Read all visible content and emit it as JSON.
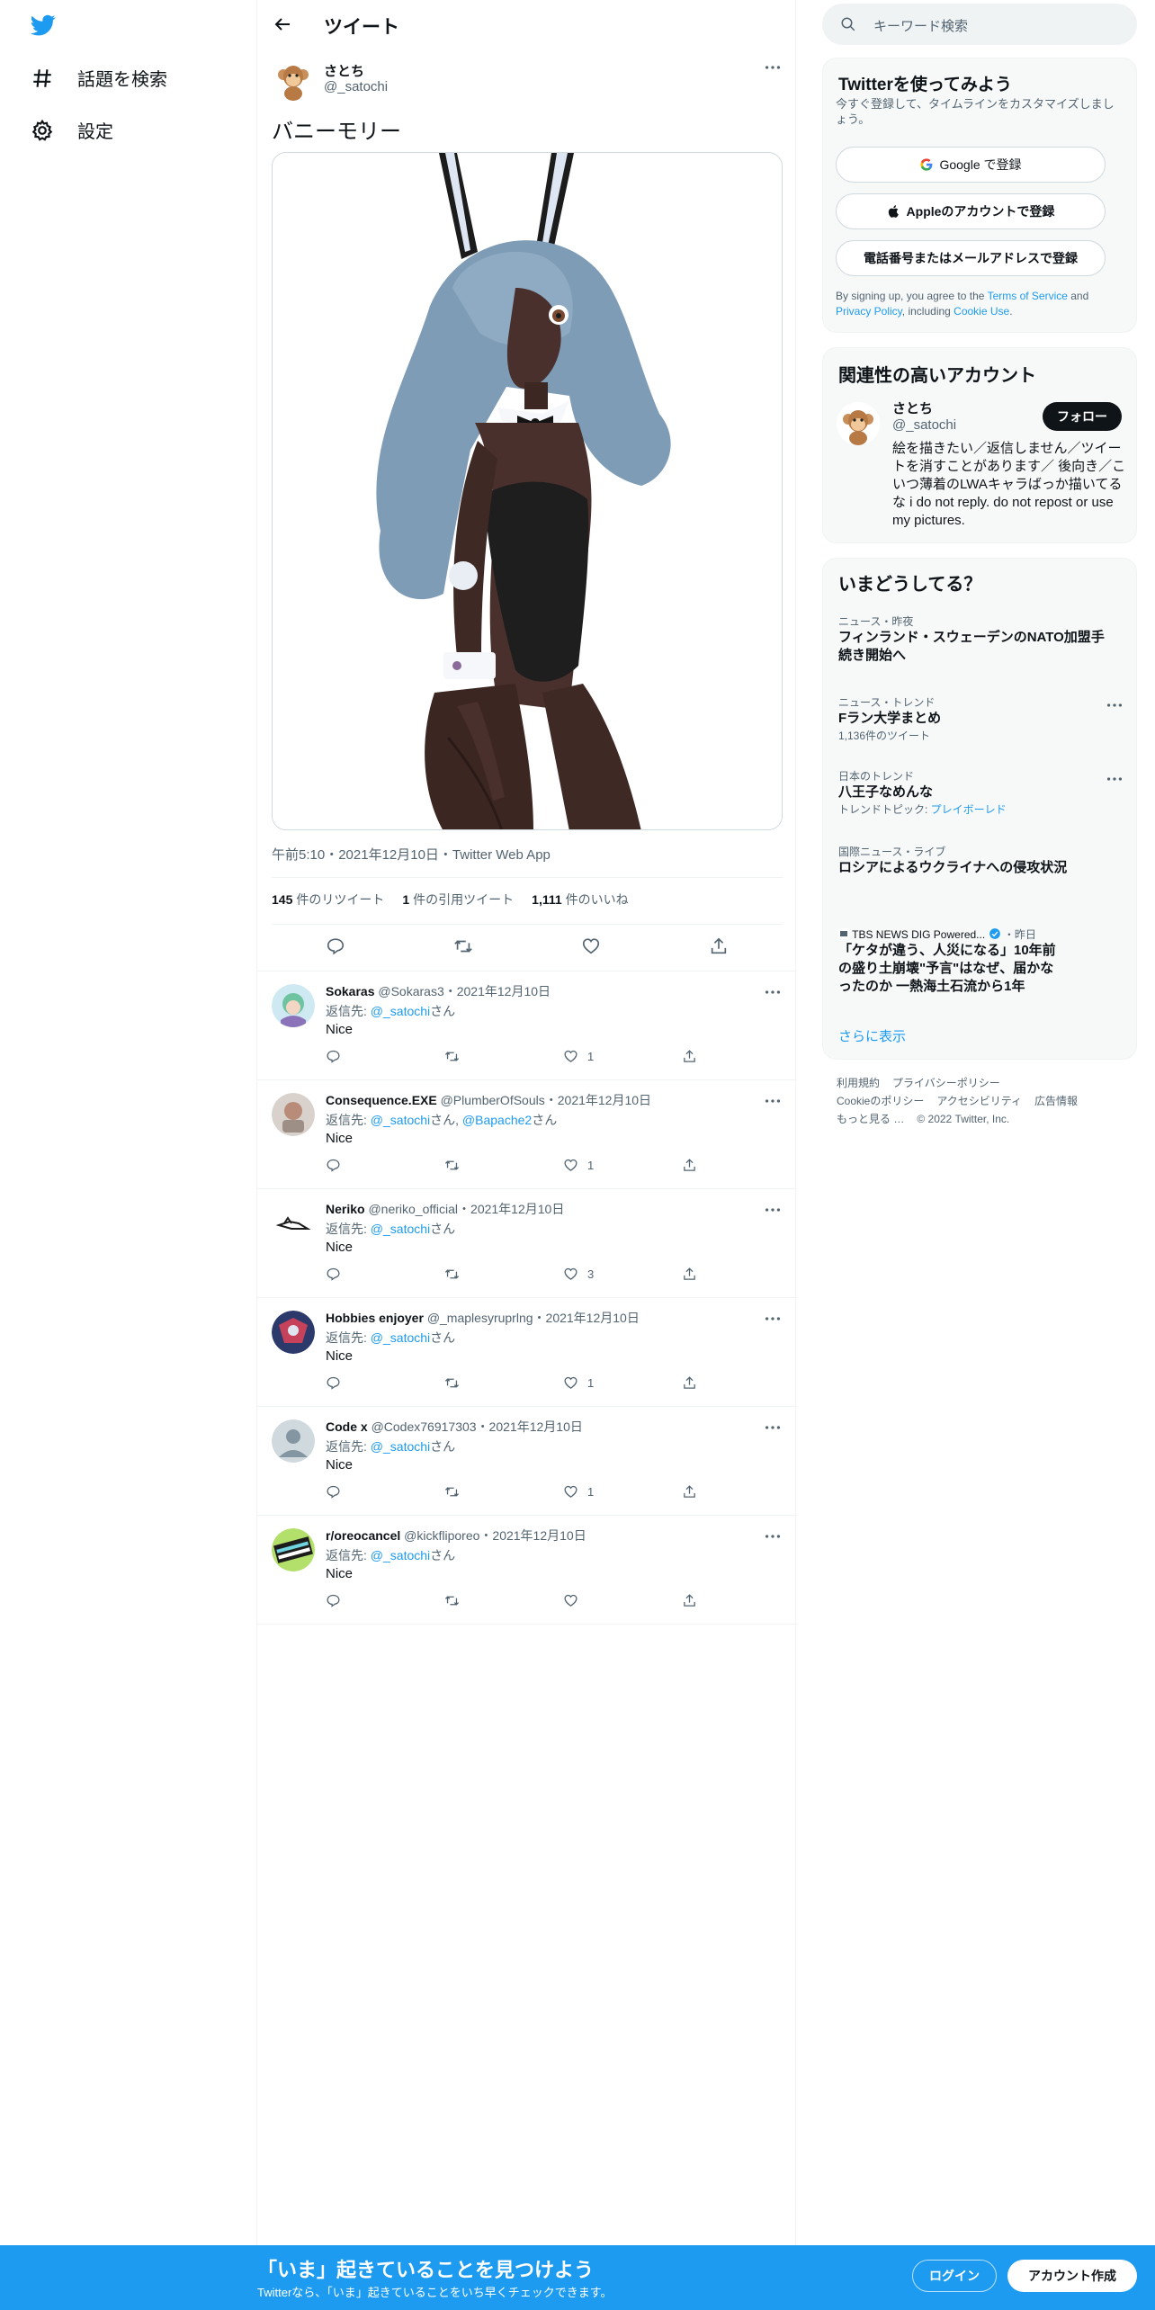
{
  "nav": {
    "logo": "twitter-bird-icon",
    "items": [
      {
        "label": "話題を検索",
        "icon": "hashtag-icon"
      },
      {
        "label": "設定",
        "icon": "gear-icon"
      }
    ]
  },
  "header": {
    "title": "ツイート"
  },
  "tweet": {
    "author_name": "さとち",
    "author_handle": "@_satochi",
    "text": "バニーモリー",
    "meta": "午前5:10・2021年12月10日・Twitter Web App",
    "stats": {
      "retweets_count": "145",
      "retweets_label": "件のリツイート",
      "quotes_count": "1",
      "quotes_label": "件の引用ツイート",
      "likes_count": "1,111",
      "likes_label": "件のいいね"
    }
  },
  "replies": [
    {
      "name": "Sokaras",
      "handle": "@Sokaras3",
      "date": "・2021年12月10日",
      "reply_prefix": "返信先: ",
      "mention": "@_satochi",
      "mention2": "",
      "suffix": "さん",
      "text": "Nice",
      "likes": "1"
    },
    {
      "name": "Consequence.EXE",
      "handle": "@PlumberOfSouls",
      "date": "・2021年12月10日",
      "reply_prefix": "返信先: ",
      "mention": "@_satochi",
      "mention2": "@Bapache2",
      "suffix": "さん",
      "text": "Nice",
      "likes": "1"
    },
    {
      "name": "Neriko",
      "handle": "@neriko_official",
      "date": "・2021年12月10日",
      "reply_prefix": "返信先: ",
      "mention": "@_satochi",
      "mention2": "",
      "suffix": "さん",
      "text": "Nice",
      "likes": "3"
    },
    {
      "name": "Hobbies enjoyer",
      "handle": "@_maplesyruprlng",
      "date": "・2021年12月10日",
      "reply_prefix": "返信先: ",
      "mention": "@_satochi",
      "mention2": "",
      "suffix": "さん",
      "text": "Nice",
      "likes": "1"
    },
    {
      "name": "Code x",
      "handle": "@Codex76917303",
      "date": "・2021年12月10日",
      "reply_prefix": "返信先: ",
      "mention": "@_satochi",
      "mention2": "",
      "suffix": "さん",
      "text": "Nice",
      "likes": "1"
    },
    {
      "name": "r/oreocancel",
      "handle": "@kickfliporeo",
      "date": "・2021年12月10日",
      "reply_prefix": "返信先: ",
      "mention": "@_satochi",
      "mention2": "",
      "suffix": "さん",
      "text": "Nice",
      "likes": ""
    }
  ],
  "sidebar": {
    "search_placeholder": "キーワード検索",
    "signup": {
      "title": "Twitterを使ってみよう",
      "subtitle": "今すぐ登録して、タイムラインをカスタマイズしましょう。",
      "google": "Google で登録",
      "apple": "Appleのアカウントで登録",
      "phone": "電話番号またはメールアドレスで登録",
      "legal_1": "By signing up, you agree to the ",
      "tos": "Terms of Service",
      "legal_2": " and ",
      "privacy": "Privacy Policy",
      "legal_3": ", including ",
      "cookie": "Cookie Use",
      "legal_4": "."
    },
    "related": {
      "title": "関連性の高いアカウント",
      "name": "さとち",
      "handle": "@_satochi",
      "follow": "フォロー",
      "bio": "絵を描きたい／返信しません／ツイートを消すことがあります／ 後向き／こいつ薄着のLWAキャラばっか描いてるな i do not reply. do not repost or use my pictures."
    },
    "trends": {
      "title": "いまどうしてる？",
      "items": [
        {
          "context": "ニュース・昨夜",
          "title": "フィンランド・スウェーデンのNATO加盟手続き開始へ",
          "count": ""
        },
        {
          "context": "ニュース・トレンド",
          "title": "Fラン大学まとめ",
          "count": "1,136件のツイート"
        },
        {
          "context": "日本のトレンド",
          "title": "八王子なめんな",
          "count": "トレンドトピック: ",
          "topic": "プレイボーレド"
        },
        {
          "context": "国際ニュース・ライブ",
          "title": "ロシアによるウクライナへの侵攻状況",
          "count": ""
        },
        {
          "context": "TBS NEWS DIG Powered...",
          "context_time": "・昨日",
          "title": "「ケタが違う、人災になる」10年前の盛り土崩壊\"予言\"はなぜ、届かなったのか 一熱海土石流から1年",
          "count": ""
        }
      ],
      "show_more": "さらに表示"
    },
    "footer": [
      "利用規約",
      "プライバシーポリシー",
      "Cookieのポリシー",
      "アクセシビリティ",
      "広告情報",
      "もっと見る …",
      "© 2022 Twitter, Inc."
    ]
  },
  "banner": {
    "title": "「いま」起きていることを見つけよう",
    "subtitle": "Twitterなら、「いま」起きていることをいち早くチェックできます。",
    "login": "ログイン",
    "signup": "アカウント作成"
  },
  "colors": {
    "accent": "#1d9bf0",
    "text": "#0f1419",
    "secondary": "#536471",
    "banner": "#1d9bf0",
    "hair": "#7e9cb6",
    "skin": "#4a302c"
  }
}
